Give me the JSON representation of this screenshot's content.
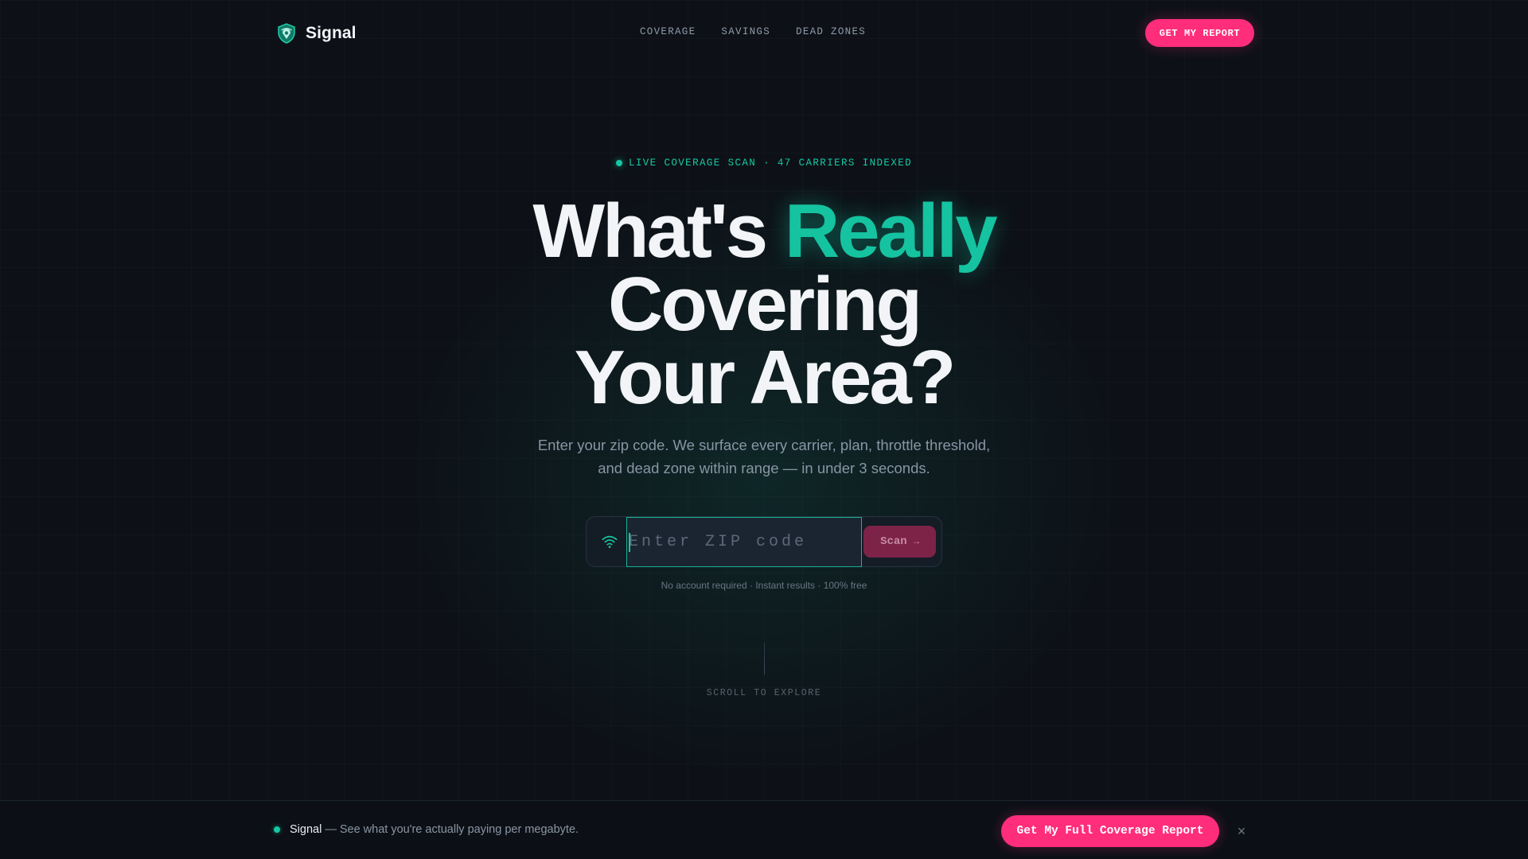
{
  "brand": {
    "name": "Signal"
  },
  "nav": {
    "links": [
      "COVERAGE",
      "SAVINGS",
      "DEAD ZONES"
    ],
    "cta_label": "GET MY REPORT"
  },
  "hero": {
    "eyebrow": "LIVE COVERAGE SCAN · 47 CARRIERS INDEXED",
    "headline": {
      "part1": "What's ",
      "accent": "Really",
      "line2": "Covering",
      "line3": "Your Area?"
    },
    "subtitle": "Enter your zip code. We surface every carrier, plan, throttle threshold, and dead zone within range — in under 3 seconds."
  },
  "search": {
    "icon": "wifi-icon",
    "placeholder": "Enter ZIP code",
    "value": "",
    "button_label": "Scan",
    "button_arrow": "→",
    "note": "No account required · Instant results · 100% free"
  },
  "scroll": {
    "label": "SCROLL TO EXPLORE"
  },
  "bottom_bar": {
    "brand": "Signal",
    "tagline": "— See what you're actually paying per megabyte.",
    "cta_label": "Get My Full Coverage Report",
    "close_glyph": "×"
  },
  "colors": {
    "background": "#0d1117",
    "accent_teal": "#15c3a0",
    "accent_pink": "#ff2d7a",
    "text_primary": "#f2f4f7",
    "text_muted": "#8995a4"
  }
}
